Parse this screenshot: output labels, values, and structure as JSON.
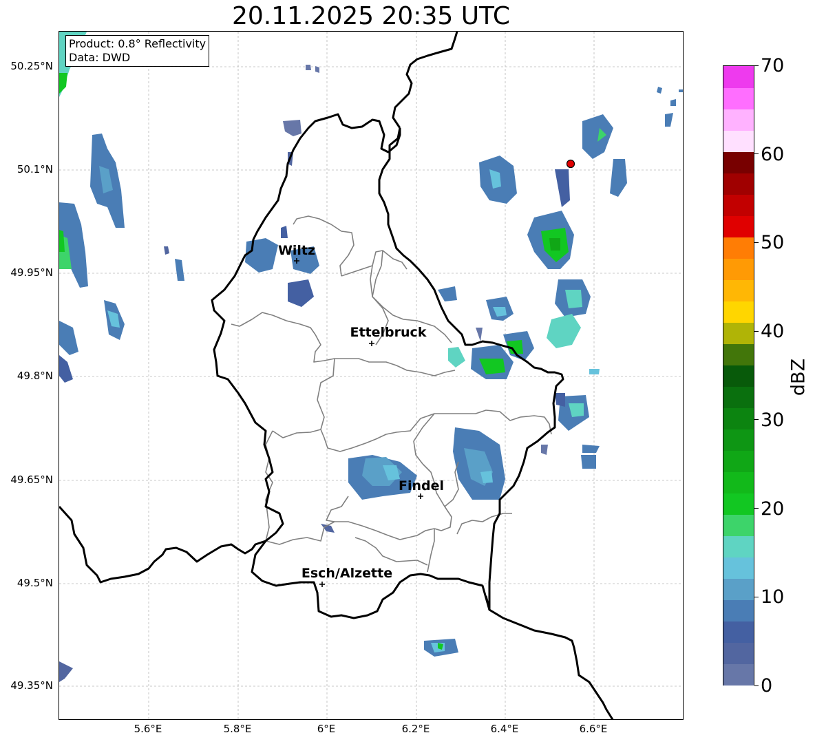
{
  "title": "20.11.2025 20:35 UTC",
  "info": {
    "product": "Product: 0.8° Reflectivity",
    "data": "Data: DWD"
  },
  "axes": {
    "lat_labels": [
      "50.25°N",
      "50.1°N",
      "49.95°N",
      "49.8°N",
      "49.65°N",
      "49.5°N",
      "49.35°N"
    ],
    "lon_labels": [
      "5.6°E",
      "5.8°E",
      "6°E",
      "6.2°E",
      "6.4°E",
      "6.6°E"
    ]
  },
  "cities": [
    {
      "name": "Wiltz",
      "lon": 5.93,
      "lat": 49.97
    },
    {
      "name": "Ettelbruck",
      "lon": 6.1,
      "lat": 49.85
    },
    {
      "name": "Findel",
      "lon": 6.21,
      "lat": 49.63
    },
    {
      "name": "Esch/Alzette",
      "lon": 5.99,
      "lat": 49.5
    }
  ],
  "radar_site": {
    "lon": 6.55,
    "lat": 50.11
  },
  "colorbar": {
    "label": "dBZ",
    "ticks": [
      "0",
      "10",
      "20",
      "30",
      "40",
      "50",
      "60",
      "70"
    ],
    "colors": [
      "#6777a8",
      "#5266a0",
      "#4460a2",
      "#4a7db5",
      "#5aa0c8",
      "#66c2dc",
      "#5fd4c2",
      "#3dd46a",
      "#12c722",
      "#12b91a",
      "#10a716",
      "#0e9614",
      "#0c8410",
      "#0a700e",
      "#085a0a",
      "#42760a",
      "#b0b406",
      "#ffd600",
      "#ffb705",
      "#ff9a05",
      "#ff7d05",
      "#e00000",
      "#c20000",
      "#a00000",
      "#780000",
      "#ffe0ff",
      "#ffb2ff",
      "#ff6eff",
      "#ee3aee"
    ]
  }
}
